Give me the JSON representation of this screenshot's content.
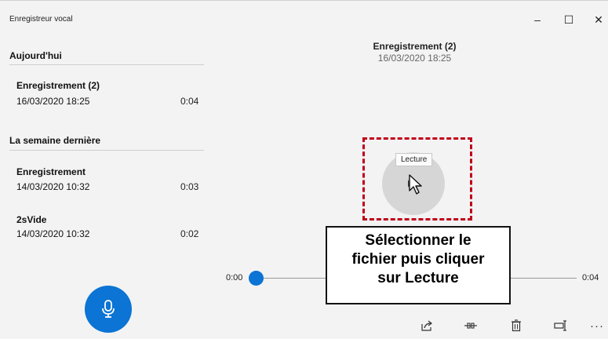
{
  "app": {
    "title": "Enregistreur vocal"
  },
  "groups": [
    {
      "heading": "Aujourd'hui",
      "items": [
        {
          "name": "Enregistrement (2)",
          "date": "16/03/2020 18:25",
          "duration": "0:04"
        }
      ]
    },
    {
      "heading": "La semaine dernière",
      "items": [
        {
          "name": "Enregistrement",
          "date": "14/03/2020 10:32",
          "duration": "0:03"
        },
        {
          "name": "2sVide",
          "date": "14/03/2020 10:32",
          "duration": "0:02"
        }
      ]
    }
  ],
  "detail": {
    "title": "Enregistrement (2)",
    "date": "16/03/2020 18:25",
    "tooltip": "Lecture",
    "time_start": "0:00",
    "time_end": "0:04",
    "progress": 0
  },
  "window_controls": {
    "minimize": "–",
    "maximize": "☐",
    "close": "✕"
  },
  "annotation": {
    "lines": [
      "Sélectionner le",
      "fichier puis cliquer",
      "sur Lecture"
    ]
  },
  "toolbar": {
    "more": "···"
  },
  "icons": [
    "microphone-icon",
    "share-icon",
    "trim-icon",
    "delete-icon",
    "rename-icon",
    "more-icon",
    "cursor-icon"
  ],
  "colors": {
    "accent": "#0b74d4",
    "annotation_border": "#c0001a",
    "background": "#f3f3f3"
  }
}
